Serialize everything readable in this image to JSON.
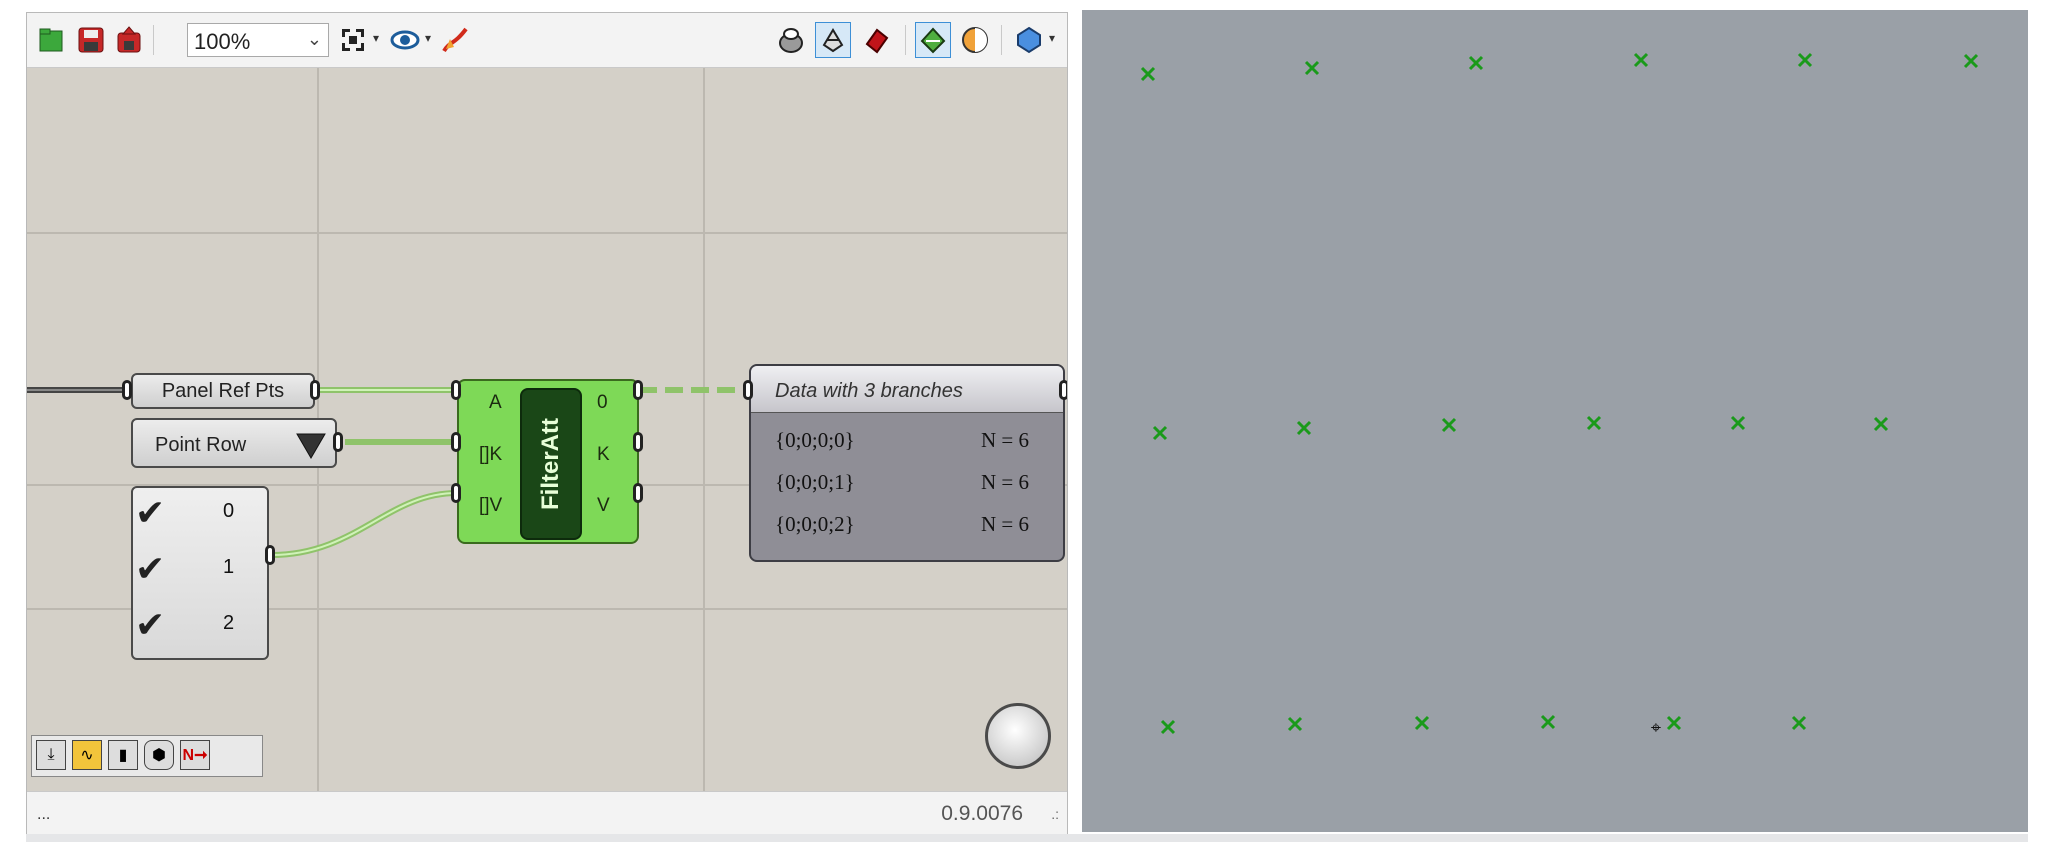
{
  "toolbar": {
    "zoom_value": "100%",
    "icons": [
      "open-file-icon",
      "save-icon",
      "save-as-icon",
      "zoom-extents-icon",
      "preview-eye-icon",
      "sketch-icon",
      "wireframe-preview-icon",
      "shaded-preview-icon",
      "solid-preview-icon",
      "selected-preview-icon",
      "material-icon",
      "display-mode-icon"
    ]
  },
  "canvas": {
    "panel_ref_pts": "Panel Ref Pts",
    "point_row": "Point Row",
    "checklist": [
      "0",
      "1",
      "2"
    ],
    "filteratt": {
      "name": "FilterAtt",
      "inputs": [
        "A",
        "[]K",
        "[]V"
      ],
      "outputs": [
        "0",
        "K",
        "V"
      ]
    },
    "data_panel": {
      "header": "Data with 3 branches",
      "branches": [
        {
          "path": "{0;0;0;0}",
          "count": "N = 6"
        },
        {
          "path": "{0;0;0;1}",
          "count": "N = 6"
        },
        {
          "path": "{0;0;0;2}",
          "count": "N = 6"
        }
      ]
    }
  },
  "statusbar": {
    "left": "...",
    "version": "0.9.0076"
  },
  "viewport": {
    "point_color": "#1a9a1a",
    "point_rows": 3,
    "points_per_row": 6
  },
  "colors": {
    "canvas": "#d4d0c8",
    "component_green": "#7ed957",
    "viewport": "#9aa0a7"
  }
}
